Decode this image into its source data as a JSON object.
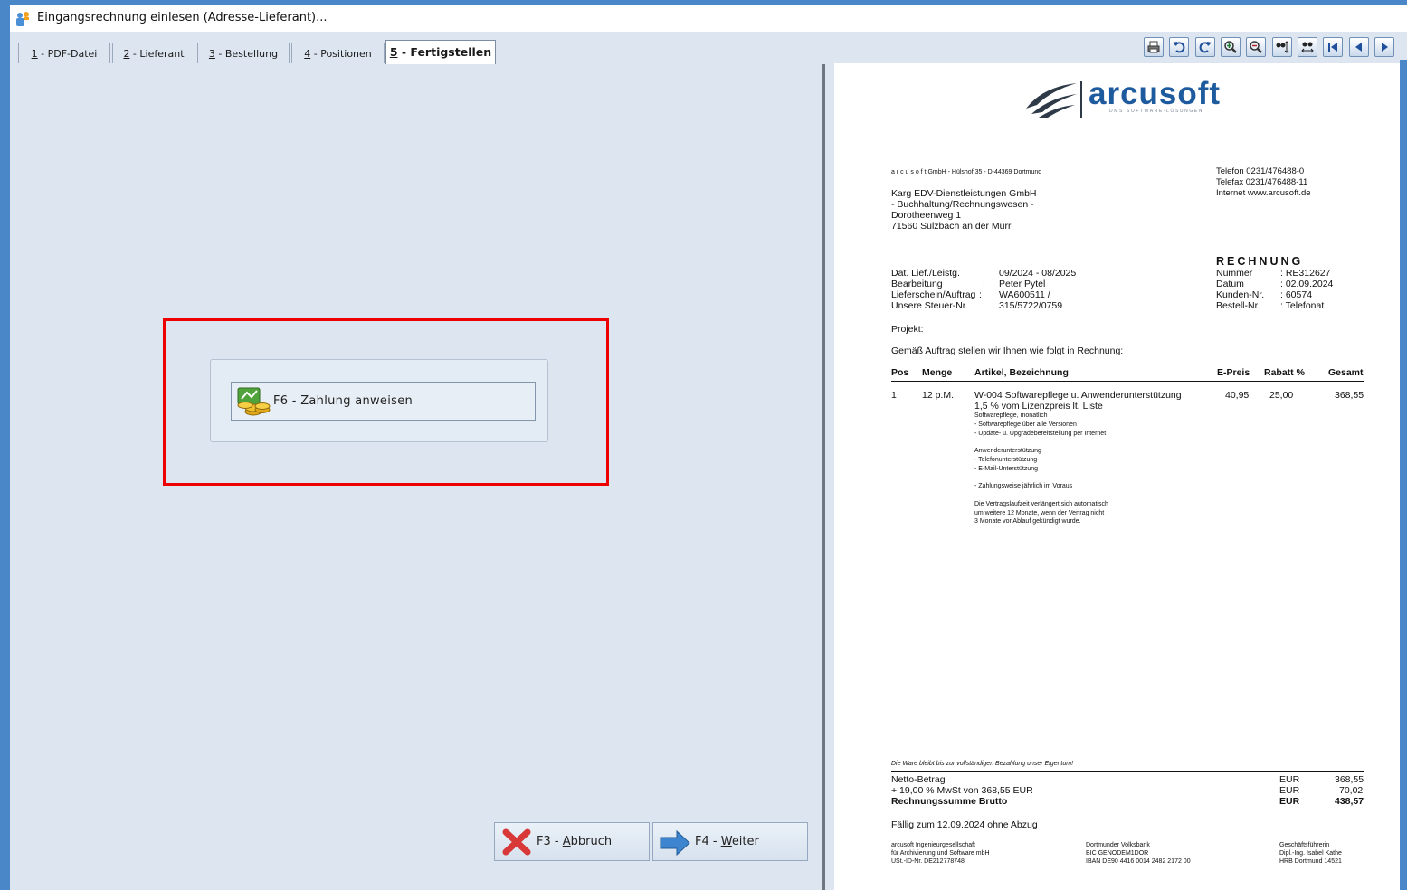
{
  "window": {
    "title": "Eingangsrechnung einlesen (Adresse-Lieferant)..."
  },
  "tabs": [
    {
      "key": "1",
      "label": " - PDF-Datei",
      "active": false
    },
    {
      "key": "2",
      "label": " - Lieferant",
      "active": false
    },
    {
      "key": "3",
      "label": " - Bestellung",
      "active": false
    },
    {
      "key": "4",
      "label": " - Positionen",
      "active": false
    },
    {
      "key": "5",
      "label": " - Fertigstellen",
      "active": true
    }
  ],
  "toolbar": {
    "icons": [
      "print-icon",
      "rotate-left-icon",
      "rotate-right-icon",
      "zoom-in-icon",
      "zoom-out-icon",
      "fit-height-icon",
      "fit-width-icon",
      "first-page-icon",
      "previous-page-icon",
      "next-page-icon"
    ]
  },
  "actions": {
    "pay_label": "F6 - Zahlung anweisen"
  },
  "nav": {
    "cancel_prefix": "F3 - ",
    "cancel_key": "A",
    "cancel_rest": "bbruch",
    "next_prefix": "F4 - ",
    "next_key": "W",
    "next_rest": "eiter"
  },
  "invoice": {
    "logo_text": "arcusoft",
    "logo_tagline": "DMS SOFTWARE-LÖSUNGEN",
    "sender_line": "a r c u s o f t  GmbH  -  Hülshof 35  -  D-44369 Dortmund",
    "contact": [
      "Telefon  0231/476488-0",
      "Telefax  0231/476488-11",
      "Internet  www.arcusoft.de"
    ],
    "recipient": [
      "Karg EDV-Dienstleistungen GmbH",
      "- Buchhaltung/Rechnungswesen -",
      "Dorotheenweg 1",
      "71560 Sulzbach an der Murr"
    ],
    "doc_title": "RECHNUNG",
    "meta_left_labels": [
      "Dat. Lief./Leistg.",
      "Bearbeitung",
      "Lieferschein/Auftrag",
      "Unsere Steuer-Nr."
    ],
    "meta_left_values": [
      "09/2024 - 08/2025",
      "Peter Pytel",
      "WA600511  /",
      "315/5722/0759"
    ],
    "meta_right_labels": [
      "Nummer",
      "Datum",
      "Kunden-Nr.",
      "Bestell-Nr."
    ],
    "meta_right_values": [
      ": RE312627",
      ": 02.09.2024",
      ": 60574",
      ": Telefonat"
    ],
    "project_label": "Projekt:",
    "intro": "Gemäß Auftrag stellen wir Ihnen wie folgt in Rechnung:",
    "table_headers": [
      "Pos",
      "Menge",
      "Artikel, Bezeichnung",
      "E-Preis",
      "Rabatt %",
      "Gesamt"
    ],
    "row": {
      "pos": "1",
      "menge": "12 p.M.",
      "artikel": "W-004 Softwarepflege  u. Anwenderunterstützung",
      "artikel2": "1,5 % vom Lizenzpreis lt. Liste",
      "epreis": "40,95",
      "rabatt": "25,00",
      "gesamt": "368,55"
    },
    "details": [
      "Softwarepflege, monatlich",
      "- Softwarepflege über alle Versionen",
      "- Update- u. Upgradebereitstellung per Internet",
      "",
      "Anwenderunterstützung",
      "- Telefonunterstützung",
      "- E-Mail-Unterstützung",
      "",
      "- Zahlungsweise jährlich im Voraus",
      "",
      "Die Vertragslaufzeit verlängert sich automatisch",
      "um weitere 12 Monate, wenn der Vertrag nicht",
      "3 Monate vor Ablauf gekündigt wurde."
    ],
    "footnote": "Die Ware bleibt bis zur vollständigen Bezahlung unser Eigentum!",
    "totals_labels": [
      "Netto-Betrag",
      "+ 19,00 %  MwSt von 368,55   EUR",
      "Rechnungssumme Brutto"
    ],
    "totals_currency": [
      "EUR",
      "EUR",
      "EUR"
    ],
    "totals_values": [
      "368,55",
      "70,02",
      "438,57"
    ],
    "due": "Fällig zum 12.09.2024 ohne Abzug",
    "footer_col1": [
      "arcusoft Ingenieurgesellschaft",
      "für Archivierung und Software mbH",
      "USt.-ID-Nr. DE212778748"
    ],
    "footer_col2": [
      "Dortmunder Volksbank",
      "BIC GENODEM1DOR",
      "IBAN DE90 4416 0014 2482 2172 00"
    ],
    "footer_col3": [
      "Geschäftsführerin",
      "Dipl.-Ing. Isabel Kathe",
      "HRB Dortmund 14521"
    ]
  }
}
